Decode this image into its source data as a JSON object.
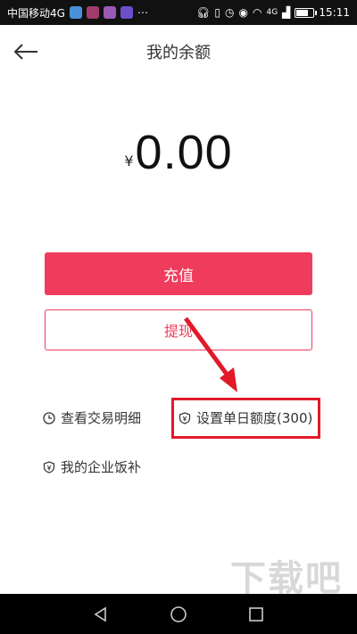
{
  "status_bar": {
    "carrier": "中国移动4G",
    "network": "4G",
    "time": "15:11",
    "battery_level": 0.75,
    "app_icon_colors": [
      "#4a90d9",
      "#a23c6e",
      "#9b59b6",
      "#6a4fc9"
    ]
  },
  "header": {
    "title": "我的余额",
    "back_icon": "arrow-left-icon"
  },
  "balance": {
    "currency": "¥",
    "amount": "0.00"
  },
  "actions": {
    "recharge_label": "充值",
    "withdraw_label": "提现"
  },
  "links": {
    "transactions": "查看交易明细",
    "daily_limit": "设置单日额度(300)",
    "corporate_meal": "我的企业饭补"
  },
  "watermark": {
    "text": "下载吧"
  },
  "colors": {
    "accent": "#f03c5c",
    "annotation": "#e11a2a"
  }
}
